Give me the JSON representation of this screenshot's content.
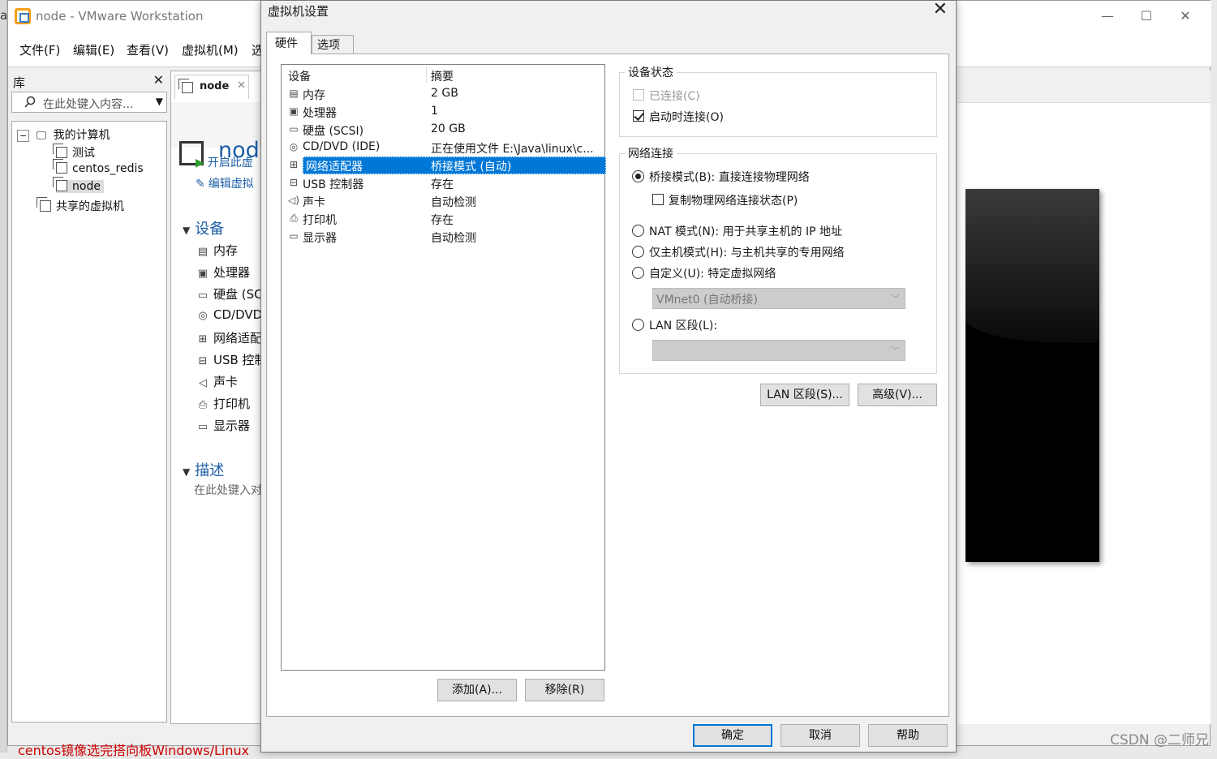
{
  "window": {
    "title": "node - VMware Workstation",
    "left_strip_text": "ai",
    "controls": {
      "minimize": "—",
      "maximize": "☐",
      "close": "✕"
    }
  },
  "menubar": [
    "文件(F)",
    "编辑(E)",
    "查看(V)",
    "虚拟机(M)",
    "选"
  ],
  "library": {
    "title": "库",
    "close": "✕",
    "search_placeholder": "在此处键入内容...",
    "tree": {
      "my_computer": "我的计算机",
      "vms": [
        "测试",
        "centos_redis",
        "node"
      ],
      "shared": "共享的虚拟机"
    }
  },
  "vm_tab": {
    "label": "node",
    "close": "✕"
  },
  "vm_panel": {
    "title": "node",
    "actions": [
      "开启此虚",
      "编辑虚拟"
    ],
    "devices_header": "设备",
    "devices": [
      "内存",
      "处理器",
      "硬盘 (SC",
      "CD/DVD",
      "网络适配",
      "USB 控制",
      "声卡",
      "打印机",
      "显示器"
    ],
    "desc_header": "描述",
    "desc_placeholder": "在此处键入对"
  },
  "dialog": {
    "title": "虚拟机设置",
    "close": "✕",
    "tabs": [
      "硬件",
      "选项"
    ],
    "list_headers": {
      "device": "设备",
      "summary": "摘要"
    },
    "devices": [
      {
        "name": "内存",
        "summary": "2 GB",
        "icon": "memory-icon",
        "glyph": "▤"
      },
      {
        "name": "处理器",
        "summary": "1",
        "icon": "processor-icon",
        "glyph": "▣"
      },
      {
        "name": "硬盘 (SCSI)",
        "summary": "20 GB",
        "icon": "harddisk-icon",
        "glyph": "▭"
      },
      {
        "name": "CD/DVD (IDE)",
        "summary": "正在使用文件 E:\\Java\\linux\\c...",
        "icon": "cdrom-icon",
        "glyph": "◎"
      },
      {
        "name": "网络适配器",
        "summary": "桥接模式 (自动)",
        "icon": "network-icon",
        "glyph": "⊞"
      },
      {
        "name": "USB 控制器",
        "summary": "存在",
        "icon": "usb-icon",
        "glyph": "⊟"
      },
      {
        "name": "声卡",
        "summary": "自动检测",
        "icon": "sound-icon",
        "glyph": "◁)"
      },
      {
        "name": "打印机",
        "summary": "存在",
        "icon": "printer-icon",
        "glyph": "⎙"
      },
      {
        "name": "显示器",
        "summary": "自动检测",
        "icon": "monitor-icon",
        "glyph": "▭"
      }
    ],
    "selected_device": "网络适配器",
    "add_button": "添加(A)...",
    "remove_button": "移除(R)",
    "device_status": {
      "title": "设备状态",
      "connected": "已连接(C)",
      "connected_checked": false,
      "connect_at_power_on": "启动时连接(O)",
      "connect_at_power_on_checked": true
    },
    "network": {
      "title": "网络连接",
      "bridged": "桥接模式(B): 直接连接物理网络",
      "replicate": "复制物理网络连接状态(P)",
      "nat": "NAT 模式(N): 用于共享主机的 IP 地址",
      "host_only": "仅主机模式(H): 与主机共享的专用网络",
      "custom": "自定义(U): 特定虚拟网络",
      "custom_value": "VMnet0 (自动桥接)",
      "lan_segment": "LAN 区段(L):",
      "lan_value": "",
      "selected": "bridged"
    },
    "lan_segments_button": "LAN 区段(S)...",
    "advanced_button": "高级(V)...",
    "ok_button": "确定",
    "cancel_button": "取消",
    "help_button": "帮助"
  },
  "watermark": "CSDN @二师兄",
  "bottom_text": "centos镜像选完搭向板Windows/Linux"
}
